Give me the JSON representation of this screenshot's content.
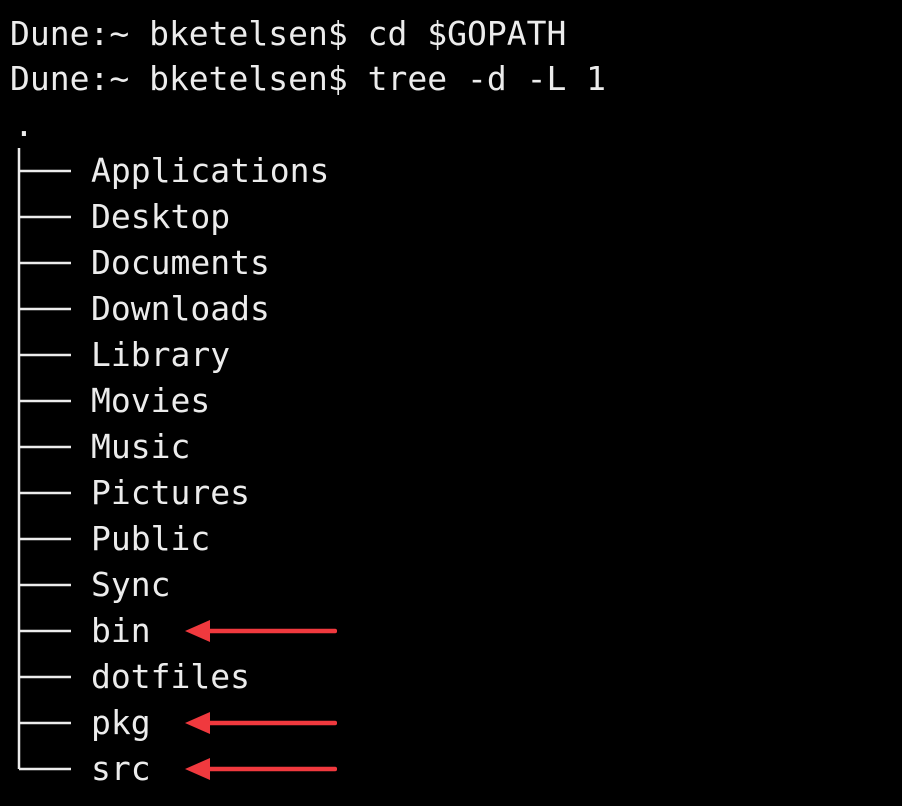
{
  "terminal": {
    "commands": [
      {
        "prompt": "Dune:~ bketelsen$",
        "command": "cd $GOPATH"
      },
      {
        "prompt": "Dune:~ bketelsen$",
        "command": "tree -d -L 1"
      }
    ],
    "tree_root": ".",
    "entries": [
      {
        "name": "Applications",
        "highlighted": false
      },
      {
        "name": "Desktop",
        "highlighted": false
      },
      {
        "name": "Documents",
        "highlighted": false
      },
      {
        "name": "Downloads",
        "highlighted": false
      },
      {
        "name": "Library",
        "highlighted": false
      },
      {
        "name": "Movies",
        "highlighted": false
      },
      {
        "name": "Music",
        "highlighted": false
      },
      {
        "name": "Pictures",
        "highlighted": false
      },
      {
        "name": "Public",
        "highlighted": false
      },
      {
        "name": "Sync",
        "highlighted": false
      },
      {
        "name": "bin",
        "highlighted": true
      },
      {
        "name": "dotfiles",
        "highlighted": false
      },
      {
        "name": "pkg",
        "highlighted": true
      },
      {
        "name": "src",
        "highlighted": true
      }
    ],
    "colors": {
      "background": "#000000",
      "text": "#ececec",
      "arrow": "#f0393e"
    },
    "icons": {
      "annotation": "arrow-left-icon"
    }
  }
}
